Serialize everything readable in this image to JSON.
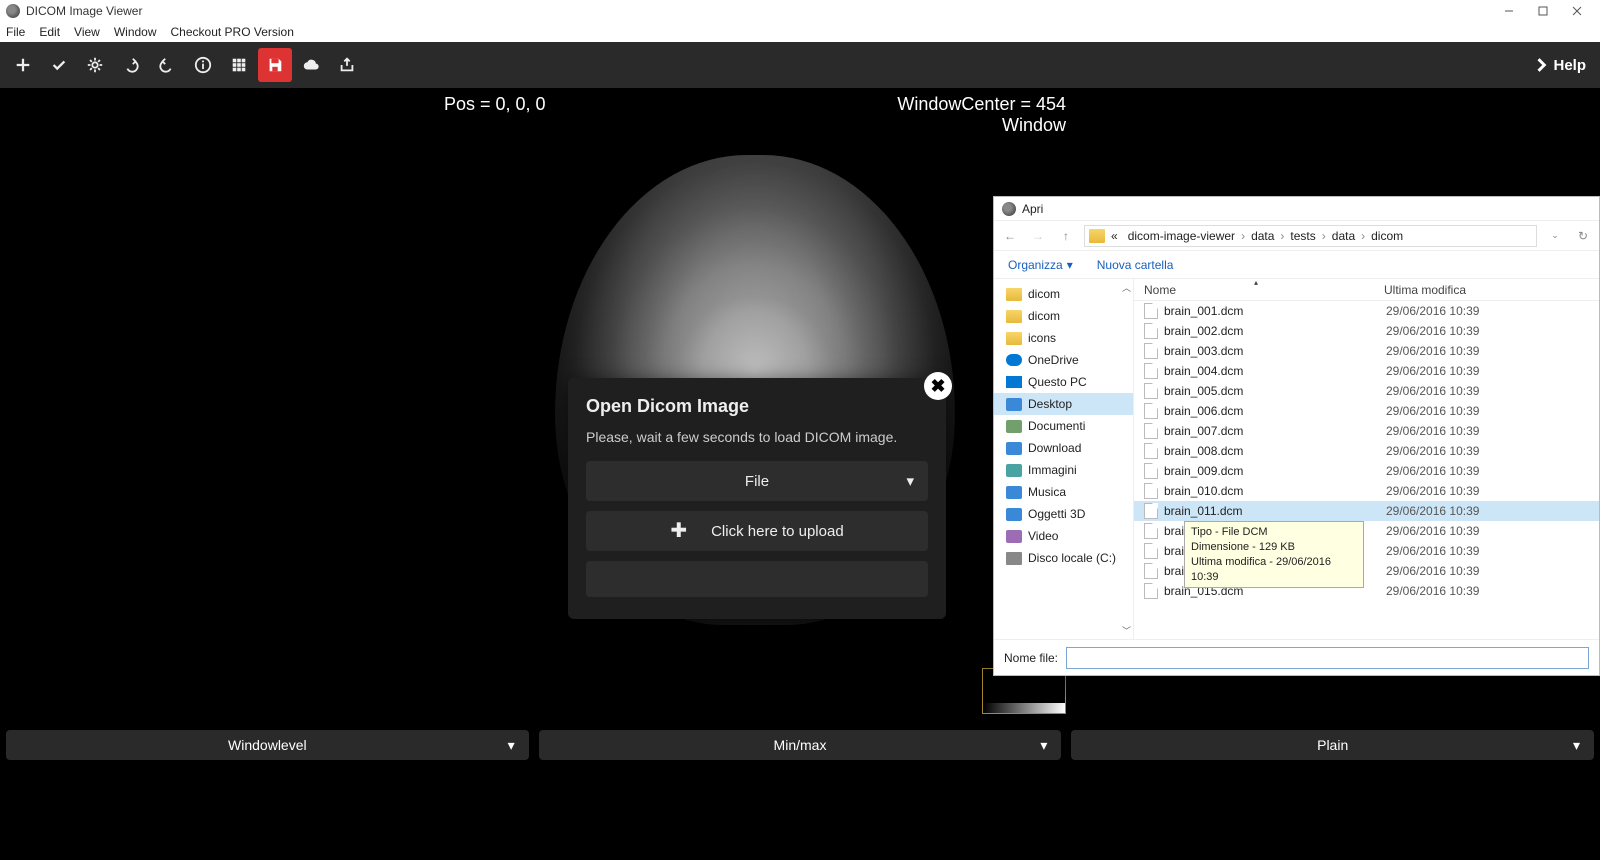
{
  "titlebar": {
    "title": "DICOM Image Viewer"
  },
  "menubar": {
    "items": [
      "File",
      "Edit",
      "View",
      "Window",
      "Checkout PRO Version"
    ]
  },
  "toolbar": {
    "help": "Help"
  },
  "overlay": {
    "pos": "Pos = 0, 0, 0",
    "wc": "WindowCenter = 454",
    "ww": "Window"
  },
  "modal": {
    "title": "Open Dicom Image",
    "msg": "Please, wait a few seconds to load DICOM image.",
    "file": "File",
    "upload": "Click here to upload"
  },
  "filedlg": {
    "title": "Apri",
    "crumbs": [
      "dicom-image-viewer",
      "data",
      "tests",
      "data",
      "dicom"
    ],
    "organize": "Organizza",
    "newfolder": "Nuova cartella",
    "tree": [
      {
        "label": "dicom",
        "icon": "folder"
      },
      {
        "label": "dicom",
        "icon": "folder"
      },
      {
        "label": "icons",
        "icon": "folder"
      },
      {
        "label": "OneDrive",
        "icon": "cloud"
      },
      {
        "label": "Questo PC",
        "icon": "pc"
      },
      {
        "label": "Desktop",
        "icon": "lib",
        "color": "#3a88d8",
        "sel": true
      },
      {
        "label": "Documenti",
        "icon": "lib",
        "color": "#72a06d"
      },
      {
        "label": "Download",
        "icon": "lib",
        "color": "#3a88d8"
      },
      {
        "label": "Immagini",
        "icon": "lib",
        "color": "#4aa3a3"
      },
      {
        "label": "Musica",
        "icon": "lib",
        "color": "#3a88d8"
      },
      {
        "label": "Oggetti 3D",
        "icon": "lib",
        "color": "#3a88d8"
      },
      {
        "label": "Video",
        "icon": "lib",
        "color": "#9c6db5"
      },
      {
        "label": "Disco locale (C:)",
        "icon": "drive"
      }
    ],
    "cols": {
      "name": "Nome",
      "modified": "Ultima modifica"
    },
    "files": [
      {
        "name": "brain_001.dcm",
        "date": "29/06/2016 10:39"
      },
      {
        "name": "brain_002.dcm",
        "date": "29/06/2016 10:39"
      },
      {
        "name": "brain_003.dcm",
        "date": "29/06/2016 10:39"
      },
      {
        "name": "brain_004.dcm",
        "date": "29/06/2016 10:39"
      },
      {
        "name": "brain_005.dcm",
        "date": "29/06/2016 10:39"
      },
      {
        "name": "brain_006.dcm",
        "date": "29/06/2016 10:39"
      },
      {
        "name": "brain_007.dcm",
        "date": "29/06/2016 10:39"
      },
      {
        "name": "brain_008.dcm",
        "date": "29/06/2016 10:39"
      },
      {
        "name": "brain_009.dcm",
        "date": "29/06/2016 10:39"
      },
      {
        "name": "brain_010.dcm",
        "date": "29/06/2016 10:39"
      },
      {
        "name": "brain_011.dcm",
        "date": "29/06/2016 10:39",
        "sel": true
      },
      {
        "name": "brain_",
        "date": "29/06/2016 10:39",
        "tooltip": true
      },
      {
        "name": "brain_",
        "date": "29/06/2016 10:39"
      },
      {
        "name": "brain_",
        "date": "29/06/2016 10:39"
      },
      {
        "name": "brain_015.dcm",
        "date": "29/06/2016 10:39"
      }
    ],
    "tooltip": {
      "line1": "Tipo - File DCM",
      "line2": "Dimensione - 129 KB",
      "line3": "Ultima modifica - 29/06/2016 10:39"
    },
    "filename_label": "Nome file:",
    "filename_value": ""
  },
  "bottom": {
    "items": [
      "Windowlevel",
      "Min/max",
      "Plain"
    ]
  }
}
